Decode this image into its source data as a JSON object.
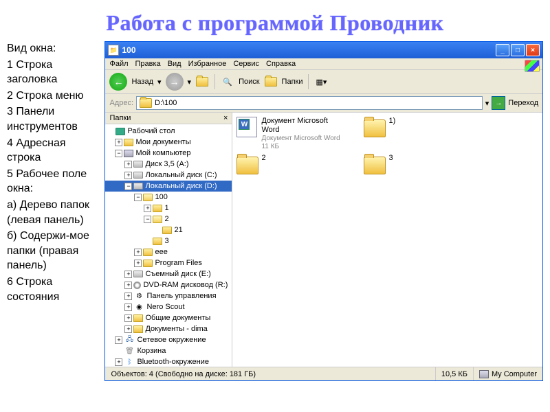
{
  "slide_title": "Работа с программой Проводник",
  "notes": [
    "Вид окна:",
    "1 Строка заголовка",
    "2 Строка меню",
    "3 Панели инструментов",
    "4 Адресная строка",
    "5 Рабочее поле окна:",
    "а) Дерево папок (левая панель)",
    "б) Содержи-мое папки (правая панель)",
    "6 Строка состояния"
  ],
  "window": {
    "title": "100",
    "menu": [
      "Файл",
      "Правка",
      "Вид",
      "Избранное",
      "Сервис",
      "Справка"
    ],
    "toolbar": {
      "back": "Назад",
      "search": "Поиск",
      "folders": "Папки"
    },
    "address": {
      "label": "Адрес:",
      "path": "D:\\100",
      "go": "Переход"
    },
    "tree": {
      "header": "Папки",
      "root": "Рабочий стол",
      "mydocs": "Мои документы",
      "mypc": "Мой компьютер",
      "floppy": "Диск 3,5 (A:)",
      "diskC": "Локальный диск (C:)",
      "diskD": "Локальный диск (D:)",
      "f100": "100",
      "f1": "1",
      "f2": "2",
      "f21": "21",
      "f3": "3",
      "eee": "eee",
      "pf": "Program Files",
      "remE": "Съемный диск (E:)",
      "dvd": "DVD-RAM дисковод (R:)",
      "cpanel": "Панель управления",
      "nero": "Nero Scout",
      "shared": "Общие документы",
      "dima": "Документы - dima",
      "net": "Сетевое окружение",
      "bin": "Корзина",
      "bt": "Bluetooth-окружение",
      "folder": "folder"
    },
    "items": {
      "word": {
        "name": "Документ Microsoft Word",
        "type": "Документ Microsoft Word",
        "size": "11 КБ"
      },
      "i1": "1)",
      "i2": "2",
      "i3": "3"
    },
    "status": {
      "main": "Объектов: 4 (Свободно на диске: 181 ГБ)",
      "size": "10,5 КБ",
      "loc": "My Computer"
    }
  }
}
